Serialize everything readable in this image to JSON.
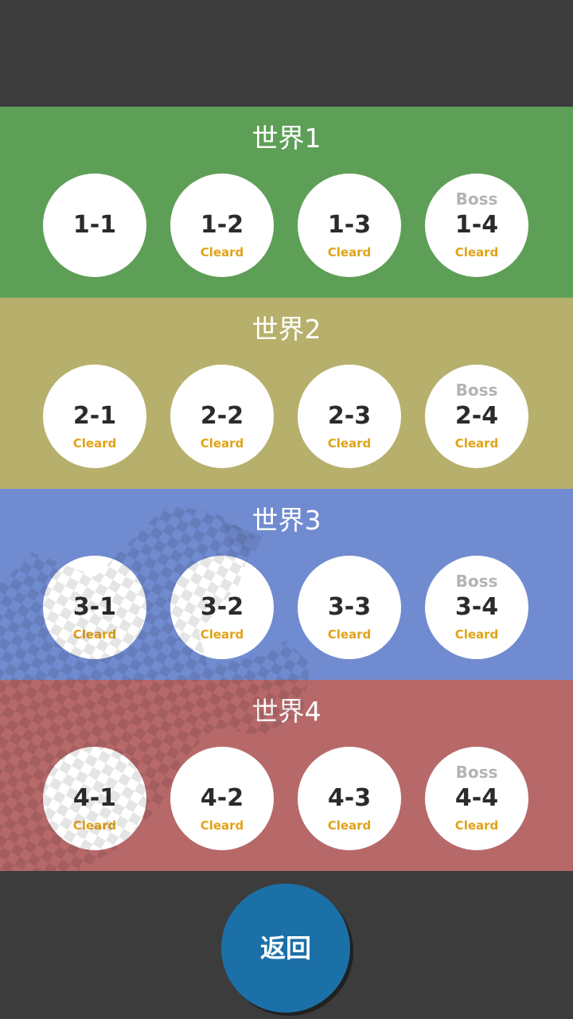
{
  "colors": {
    "background": "#3c3c3c",
    "stage_circle": "#ffffff",
    "clear_text": "#e0a31a",
    "boss_text": "#b3b3b3",
    "back_button": "#1b70a8"
  },
  "worlds": [
    {
      "title": "世界1",
      "color": "#5e9f57",
      "stages": [
        {
          "label": "1-1",
          "boss": "",
          "status": ""
        },
        {
          "label": "1-2",
          "boss": "",
          "status": "Cleard"
        },
        {
          "label": "1-3",
          "boss": "",
          "status": "Cleard"
        },
        {
          "label": "1-4",
          "boss": "Boss",
          "status": "Cleard"
        }
      ]
    },
    {
      "title": "世界2",
      "color": "#b7b06d",
      "stages": [
        {
          "label": "2-1",
          "boss": "",
          "status": "Cleard"
        },
        {
          "label": "2-2",
          "boss": "",
          "status": "Cleard"
        },
        {
          "label": "2-3",
          "boss": "",
          "status": "Cleard"
        },
        {
          "label": "2-4",
          "boss": "Boss",
          "status": "Cleard"
        }
      ]
    },
    {
      "title": "世界3",
      "color": "#708bd0",
      "stages": [
        {
          "label": "3-1",
          "boss": "",
          "status": "Cleard"
        },
        {
          "label": "3-2",
          "boss": "",
          "status": "Cleard"
        },
        {
          "label": "3-3",
          "boss": "",
          "status": "Cleard"
        },
        {
          "label": "3-4",
          "boss": "Boss",
          "status": "Cleard"
        }
      ]
    },
    {
      "title": "世界4",
      "color": "#b7696a",
      "stages": [
        {
          "label": "4-1",
          "boss": "",
          "status": "Cleard"
        },
        {
          "label": "4-2",
          "boss": "",
          "status": "Cleard"
        },
        {
          "label": "4-3",
          "boss": "",
          "status": "Cleard"
        },
        {
          "label": "4-4",
          "boss": "Boss",
          "status": "Cleard"
        }
      ]
    }
  ],
  "back_button": {
    "label": "返回"
  }
}
